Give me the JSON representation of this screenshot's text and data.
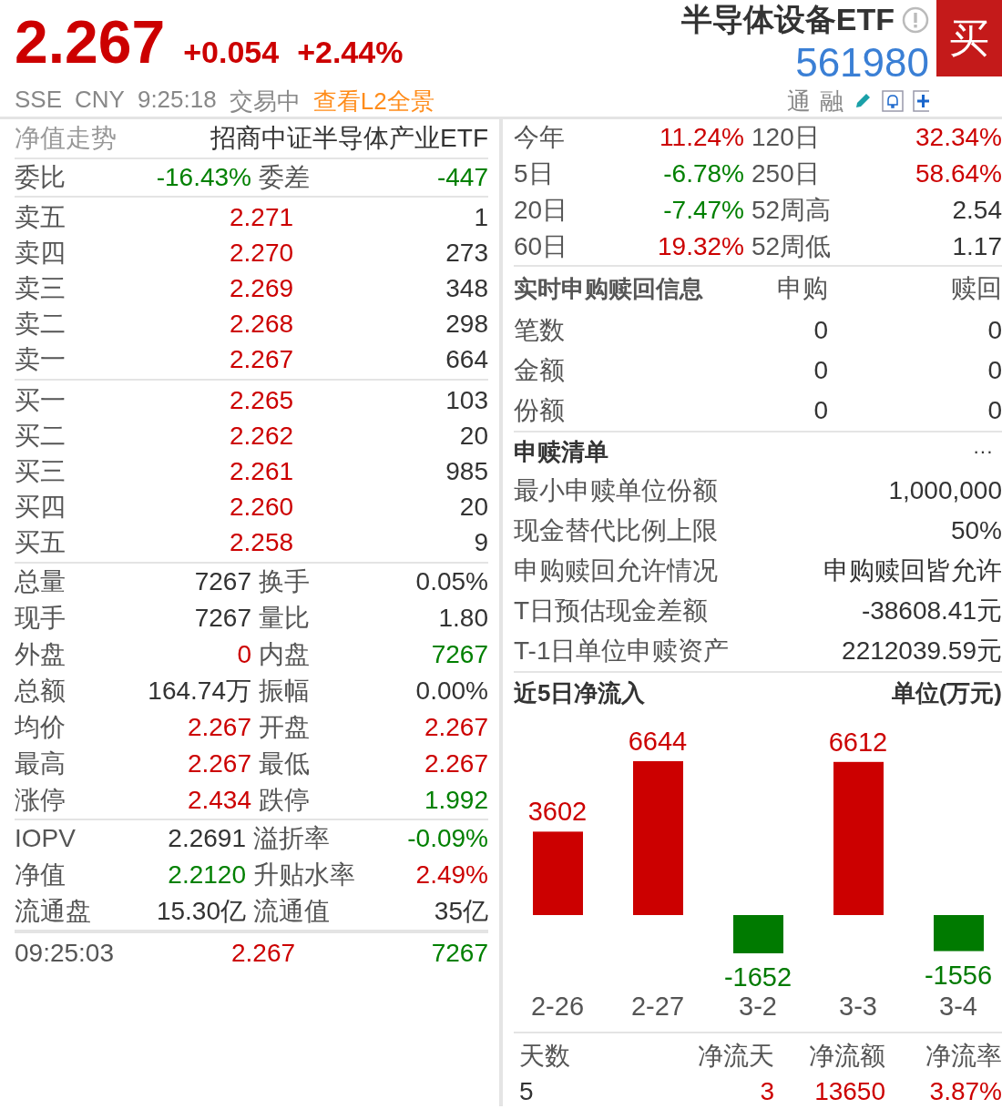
{
  "quote": {
    "price": "2.267",
    "change": "+0.054",
    "change_pct": "+2.44%",
    "color": "#cc0000",
    "name": "半导体设备ETF",
    "code": "561980",
    "buy": "买",
    "exchange": "SSE",
    "currency": "CNY",
    "time": "9:25:18",
    "status": "交易中",
    "l2_link": "查看L2全景",
    "tags": [
      "通",
      "融"
    ]
  },
  "left": {
    "nav_link": "净值走势",
    "fund_name": "招商中证半导体产业ETF",
    "committee": [
      {
        "label": "委比",
        "value": "-16.43%",
        "color": "#008000"
      },
      {
        "label": "委差",
        "value": "-447",
        "color": "#008000"
      }
    ],
    "asks": [
      {
        "label": "卖五",
        "price": "2.271",
        "volume": "1",
        "color": "#cc0000"
      },
      {
        "label": "卖四",
        "price": "2.270",
        "volume": "273",
        "color": "#cc0000"
      },
      {
        "label": "卖三",
        "price": "2.269",
        "volume": "348",
        "color": "#cc0000"
      },
      {
        "label": "卖二",
        "price": "2.268",
        "volume": "298",
        "color": "#cc0000"
      },
      {
        "label": "卖一",
        "price": "2.267",
        "volume": "664",
        "color": "#cc0000"
      }
    ],
    "bids": [
      {
        "label": "买一",
        "price": "2.265",
        "volume": "103",
        "color": "#cc0000"
      },
      {
        "label": "买二",
        "price": "2.262",
        "volume": "20",
        "color": "#cc0000"
      },
      {
        "label": "买三",
        "price": "2.261",
        "volume": "985",
        "color": "#cc0000"
      },
      {
        "label": "买四",
        "price": "2.260",
        "volume": "20",
        "color": "#cc0000"
      },
      {
        "label": "买五",
        "price": "2.258",
        "volume": "9",
        "color": "#cc0000"
      }
    ],
    "stats": [
      {
        "items": [
          {
            "label": "总量",
            "value": "7267",
            "color": "#333333"
          },
          {
            "label": "换手",
            "value": "0.05%",
            "color": "#333333"
          }
        ]
      },
      {
        "items": [
          {
            "label": "现手",
            "value": "7267",
            "color": "#333333"
          },
          {
            "label": "量比",
            "value": "1.80",
            "color": "#333333"
          }
        ]
      },
      {
        "items": [
          {
            "label": "外盘",
            "value": "0",
            "color": "#cc0000"
          },
          {
            "label": "内盘",
            "value": "7267",
            "color": "#008000"
          }
        ]
      },
      {
        "items": [
          {
            "label": "总额",
            "value": "164.74万",
            "color": "#333333"
          },
          {
            "label": "振幅",
            "value": "0.00%",
            "color": "#333333"
          }
        ]
      },
      {
        "items": [
          {
            "label": "均价",
            "value": "2.267",
            "color": "#cc0000"
          },
          {
            "label": "开盘",
            "value": "2.267",
            "color": "#cc0000"
          }
        ]
      },
      {
        "items": [
          {
            "label": "最高",
            "value": "2.267",
            "color": "#cc0000"
          },
          {
            "label": "最低",
            "value": "2.267",
            "color": "#cc0000"
          }
        ]
      },
      {
        "items": [
          {
            "label": "涨停",
            "value": "2.434",
            "color": "#cc0000"
          },
          {
            "label": "跌停",
            "value": "1.992",
            "color": "#008000"
          }
        ]
      }
    ],
    "etf_stats": [
      {
        "items": [
          {
            "label": "IOPV",
            "value": "2.2691",
            "color": "#333333"
          },
          {
            "label": "溢折率",
            "value": "-0.09%",
            "color": "#008000"
          }
        ]
      },
      {
        "items": [
          {
            "label": "净值",
            "value": "2.2120",
            "color": "#008000"
          },
          {
            "label": "升贴水率",
            "value": "2.49%",
            "color": "#cc0000"
          }
        ]
      },
      {
        "items": [
          {
            "label": "流通盘",
            "value": "15.30亿",
            "color": "#333333"
          },
          {
            "label": "流通值",
            "value": "35亿",
            "color": "#333333"
          }
        ]
      }
    ],
    "tick": {
      "time": "09:25:03",
      "price": {
        "value": "2.267",
        "color": "#cc0000"
      },
      "volume": {
        "value": "7267",
        "color": "#008000"
      }
    }
  },
  "right": {
    "returns": [
      {
        "items": [
          {
            "label": "今年",
            "value": "11.24%",
            "color": "#cc0000"
          },
          {
            "label": "120日",
            "value": "32.34%",
            "color": "#cc0000"
          }
        ]
      },
      {
        "items": [
          {
            "label": "5日",
            "value": "-6.78%",
            "color": "#008000"
          },
          {
            "label": "250日",
            "value": "58.64%",
            "color": "#cc0000"
          }
        ]
      },
      {
        "items": [
          {
            "label": "20日",
            "value": "-7.47%",
            "color": "#008000"
          },
          {
            "label": "52周高",
            "value": "2.54",
            "color": "#333333"
          }
        ]
      },
      {
        "items": [
          {
            "label": "60日",
            "value": "19.32%",
            "color": "#cc0000"
          },
          {
            "label": "52周低",
            "value": "1.17",
            "color": "#333333"
          }
        ]
      }
    ],
    "realtime": {
      "title": "实时申购赎回信息",
      "columns": [
        "申购",
        "赎回"
      ],
      "rows": [
        {
          "label": "笔数",
          "values": [
            "0",
            "0"
          ]
        },
        {
          "label": "金额",
          "values": [
            "0",
            "0"
          ]
        },
        {
          "label": "份额",
          "values": [
            "0",
            "0"
          ]
        }
      ]
    },
    "list": {
      "title": "申赎清单",
      "more": "···",
      "rows": [
        {
          "label": "最小申赎单位份额",
          "value": "1,000,000"
        },
        {
          "label": "现金替代比例上限",
          "value": "50%"
        },
        {
          "label": "申购赎回允许情况",
          "value": "申购赎回皆允许"
        },
        {
          "label": "T日预估现金差额",
          "value": "-38608.41元"
        },
        {
          "label": "T-1日单位申赎资产",
          "value": "2212039.59元"
        }
      ]
    },
    "flow": {
      "title": "近5日净流入",
      "unit": "单位(万元)",
      "chart_data": {
        "type": "bar",
        "categories": [
          "2-26",
          "2-27",
          "3-2",
          "3-3",
          "3-4"
        ],
        "values": [
          3602,
          6644,
          -1652,
          6612,
          -1556
        ],
        "data_labels": true
      },
      "summary": {
        "columns": [
          "天数",
          "净流天",
          "净流额",
          "净流率"
        ],
        "values": [
          {
            "value": "5",
            "color": "#333333"
          },
          {
            "value": "3",
            "color": "#cc0000"
          },
          {
            "value": "13650",
            "color": "#cc0000"
          },
          {
            "value": "3.87%",
            "color": "#cc0000"
          }
        ]
      }
    }
  }
}
